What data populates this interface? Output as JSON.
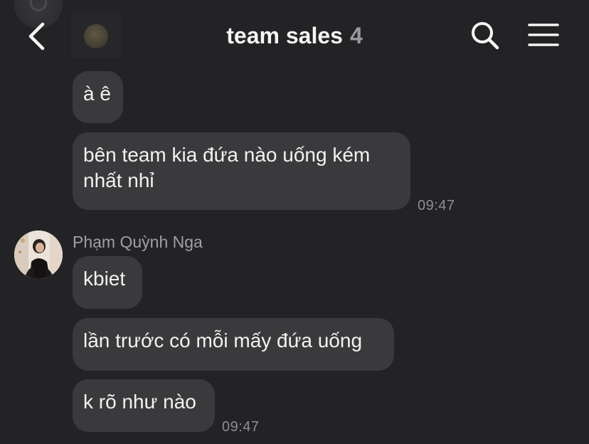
{
  "header": {
    "title": "team sales",
    "member_count": "4"
  },
  "messages": [
    {
      "text": "à ê"
    },
    {
      "text": "bên team kia đứa nào uống kém nhất nhỉ",
      "time": "09:47"
    },
    {
      "sender": "Phạm Quỳnh Nga",
      "text": "kbiet"
    },
    {
      "text": "lần trước có mỗi mấy đứa uống"
    },
    {
      "text": "k rõ như nào",
      "time": "09:47"
    }
  ],
  "icons": {
    "back": "chevron-left-icon",
    "search": "search-icon",
    "menu": "hamburger-menu-icon"
  },
  "colors": {
    "background": "#232325",
    "bubble": "#3a3a3c",
    "text": "#f2f2f2",
    "muted": "#8e8e93"
  }
}
